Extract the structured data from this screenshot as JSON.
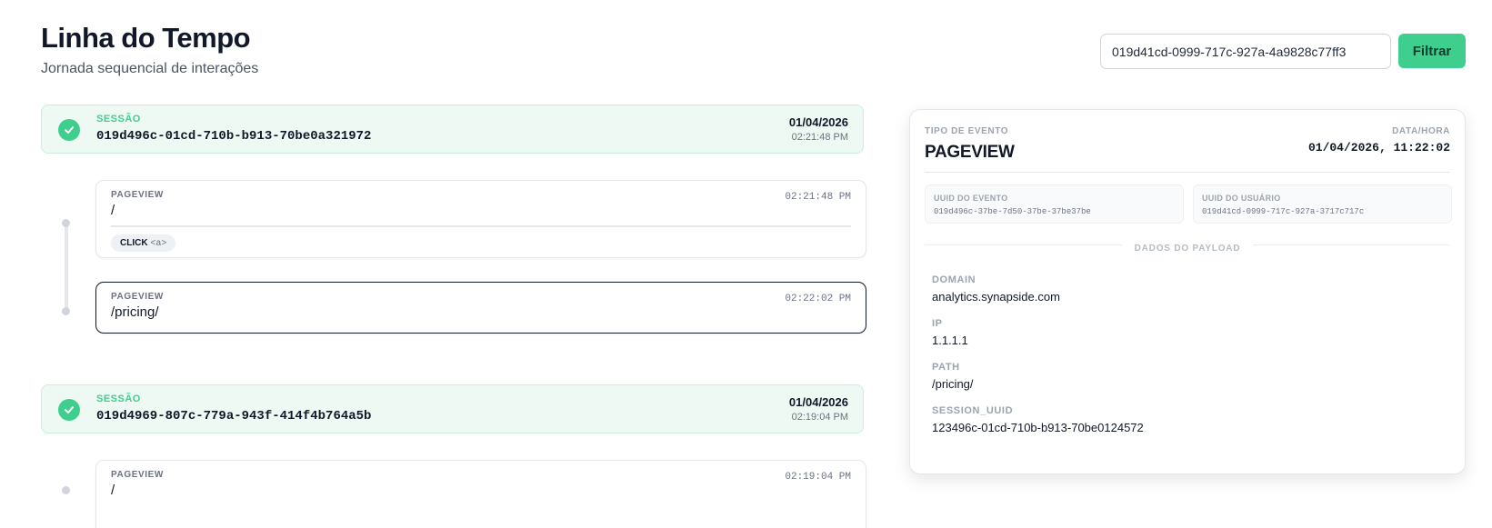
{
  "header": {
    "title": "Linha do Tempo",
    "subtitle": "Jornada sequencial de interações"
  },
  "filter": {
    "value": "019d41cd-0999-717c-927a-4a9828c77ff3",
    "button_label": "Filtrar"
  },
  "sessions": [
    {
      "label": "SESSÃO",
      "uuid": "019d496c-01cd-710b-b913-70be0a321972",
      "date": "01/04/2026",
      "time": "02:21:48 PM",
      "events": [
        {
          "type": "PAGEVIEW",
          "path": "/",
          "time": "02:21:48 PM",
          "badge_action": "CLICK",
          "badge_tag": "<a>"
        },
        {
          "type": "PAGEVIEW",
          "path": "/pricing/",
          "time": "02:22:02 PM",
          "selected": true
        }
      ]
    },
    {
      "label": "SESSÃO",
      "uuid": "019d4969-807c-779a-943f-414f4b764a5b",
      "date": "01/04/2026",
      "time": "02:19:04 PM",
      "events": [
        {
          "type": "PAGEVIEW",
          "path": "/",
          "time": "02:19:04 PM"
        }
      ]
    }
  ],
  "detail": {
    "type_caption": "TIPO DE EVENTO",
    "type": "PAGEVIEW",
    "date_caption": "DATA/HORA",
    "date": "01/04/2026, 11:22:02",
    "event_uuid_caption": "UUID DO EVENTO",
    "event_uuid": "019d496c-37be-7d50-37be-37be37be",
    "user_uuid_caption": "UUID DO USUÁRIO",
    "user_uuid": "019d41cd-0999-717c-927a-3717c717c",
    "payload_title": "DADOS DO PAYLOAD",
    "payload": [
      {
        "key": "DOMAIN",
        "value": "analytics.synapside.com"
      },
      {
        "key": "IP",
        "value": "1.1.1.1"
      },
      {
        "key": "PATH",
        "value": "/pricing/"
      },
      {
        "key": "SESSION_UUID",
        "value": "123496c-01cd-710b-b913-70be0124572"
      }
    ]
  },
  "colors": {
    "accent": "#3ecf8e",
    "session_bg": "#eef9f4",
    "text": "#111827"
  },
  "icons": {
    "session_status": "check-circle-icon"
  }
}
